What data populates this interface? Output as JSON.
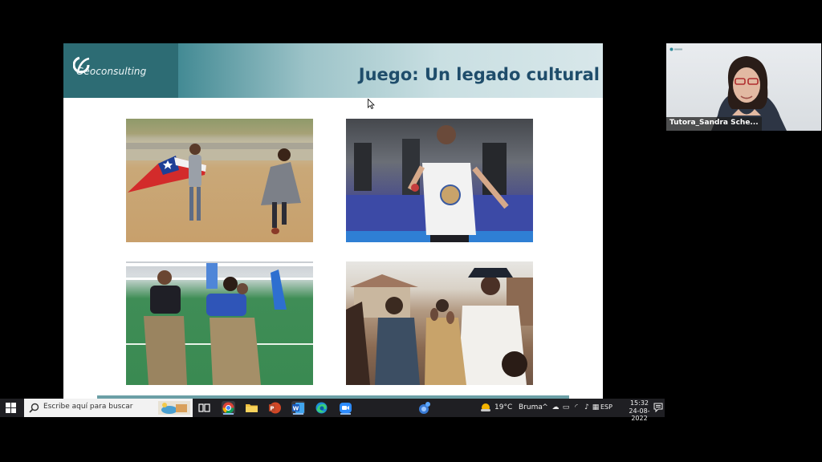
{
  "slide": {
    "logo_text": "Geoconsulting",
    "title": "Juego: Un legado cultural"
  },
  "video": {
    "participant_name": "Tutora_Sandra Sche..."
  },
  "taskbar": {
    "search_placeholder": "Escribe aquí para buscar",
    "apps": [
      "task-view",
      "chrome",
      "file-explorer",
      "powerpoint",
      "word",
      "edge",
      "zoom"
    ],
    "weather_temp": "19°C",
    "weather_label": "Bruma",
    "language": "ESP",
    "time": "15:32",
    "date": "24-08-2022"
  },
  "colors": {
    "header_teal": "#2d6c74",
    "title_blue": "#1f4d6b",
    "taskbar": "#1f1f23"
  }
}
